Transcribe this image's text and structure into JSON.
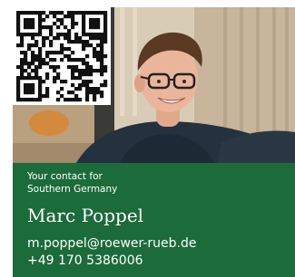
{
  "contact_card": {
    "intro_line1": "Your contact for",
    "intro_line2": "Southern Germany",
    "name": "Marc Poppel",
    "email": "m.poppel@roewer-rueb.de",
    "phone": "+49 170 5386006"
  },
  "colors": {
    "panel_green": "#1c6b3a",
    "text": "#ffffff"
  },
  "icons": {
    "qr_code": "qr-code-icon"
  }
}
